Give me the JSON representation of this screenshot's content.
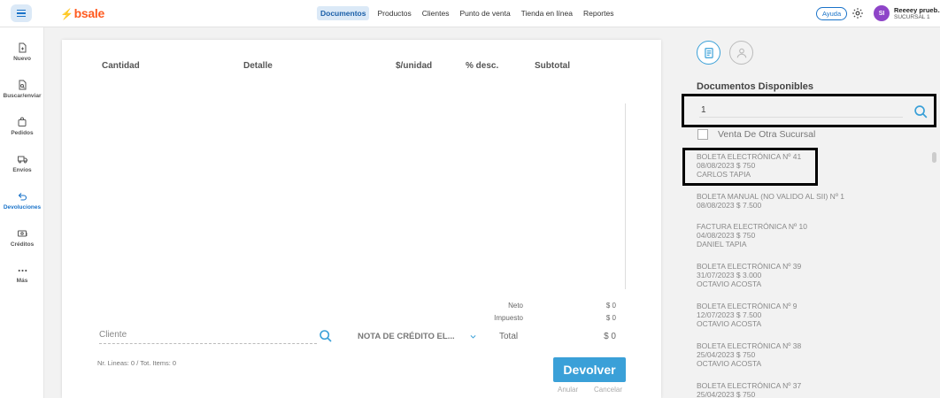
{
  "topbar": {
    "logo": "bsale",
    "nav": [
      {
        "label": "Documentos",
        "active": true
      },
      {
        "label": "Productos",
        "active": false
      },
      {
        "label": "Clientes",
        "active": false
      },
      {
        "label": "Punto de venta",
        "active": false
      },
      {
        "label": "Tienda en línea",
        "active": false
      },
      {
        "label": "Reportes",
        "active": false
      }
    ],
    "help_label": "Ayuda",
    "avatar_initials": "SI",
    "user_name": "Reeeey prueb...",
    "user_branch": "SUCURSAL 1",
    "accent_color": "#1a73c9",
    "logo_color": "#ff5a1f"
  },
  "sidebar": {
    "items": [
      {
        "label": "Nuevo",
        "icon": "new-document-icon"
      },
      {
        "label": "Buscar/enviar",
        "icon": "search-document-icon"
      },
      {
        "label": "Pedidos",
        "icon": "bag-icon"
      },
      {
        "label": "Envíos",
        "icon": "truck-icon"
      },
      {
        "label": "Devoluciones",
        "icon": "return-arrow-icon",
        "active": true
      },
      {
        "label": "Créditos",
        "icon": "credit-icon"
      },
      {
        "label": "Más",
        "icon": "more-dots-icon"
      }
    ]
  },
  "table": {
    "headers": {
      "cantidad": "Cantidad",
      "detalle": "Detalle",
      "unit_price": "$/unidad",
      "discount": "% desc.",
      "subtotal": "Subtotal"
    }
  },
  "summary": {
    "neto_label": "Neto",
    "neto_value": "$ 0",
    "impuesto_label": "Impuesto",
    "impuesto_value": "$ 0",
    "total_label": "Total",
    "total_value": "$ 0"
  },
  "form": {
    "client_placeholder": "Cliente",
    "document_type": "NOTA DE CRÉDITO EL...",
    "counts": "Nr. Lineas: 0 / Tot. Items: 0",
    "submit_label": "Devolver",
    "anular_label": "Anular",
    "cancelar_label": "Cancelar"
  },
  "right_panel": {
    "title": "Documentos Disponibles",
    "search_value": "1",
    "checkbox_label": "Venta De Otra Sucursal",
    "documents": [
      {
        "title": "BOLETA ELECTRÓNICA Nº 41",
        "date_amount": "08/08/2023 $ 750",
        "client": "CARLOS TAPIA"
      },
      {
        "title": "BOLETA MANUAL (NO VALIDO AL SII) Nº 1",
        "date_amount": "08/08/2023 $ 7.500",
        "client": ""
      },
      {
        "title": "FACTURA ELECTRÓNICA Nº 10",
        "date_amount": "04/08/2023 $ 750",
        "client": "DANIEL TAPIA"
      },
      {
        "title": "BOLETA ELECTRÓNICA Nº 39",
        "date_amount": "31/07/2023 $ 3.000",
        "client": "OCTAVIO ACOSTA"
      },
      {
        "title": "BOLETA ELECTRÓNICA Nº 9",
        "date_amount": "12/07/2023 $ 7.500",
        "client": "OCTAVIO ACOSTA"
      },
      {
        "title": "BOLETA ELECTRÓNICA Nº 38",
        "date_amount": "25/04/2023 $ 750",
        "client": "OCTAVIO ACOSTA"
      },
      {
        "title": "BOLETA ELECTRÓNICA Nº 37",
        "date_amount": "25/04/2023 $ 750",
        "client": ""
      }
    ]
  }
}
